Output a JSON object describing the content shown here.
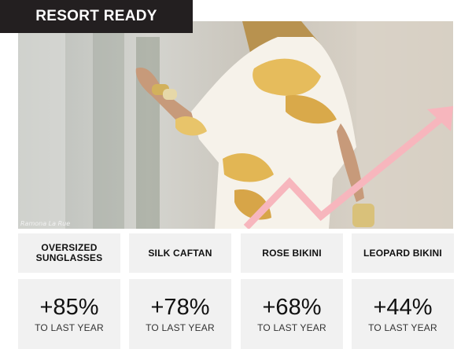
{
  "header": {
    "title": "RESORT READY"
  },
  "photo": {
    "credit": "Ramona La Rue"
  },
  "items": [
    {
      "name": "OVERSIZED SUNGLASSES",
      "change": "+85%",
      "caption": "TO LAST YEAR"
    },
    {
      "name": "SILK CAFTAN",
      "change": "+78%",
      "caption": "TO LAST YEAR"
    },
    {
      "name": "ROSE BIKINI",
      "change": "+68%",
      "caption": "TO LAST YEAR"
    },
    {
      "name": "LEOPARD BIKINI",
      "change": "+44%",
      "caption": "TO LAST YEAR"
    }
  ],
  "colors": {
    "title_bg": "#231f20",
    "card_bg": "#f1f1f1",
    "trend_arrow": "#f7b6bd"
  }
}
